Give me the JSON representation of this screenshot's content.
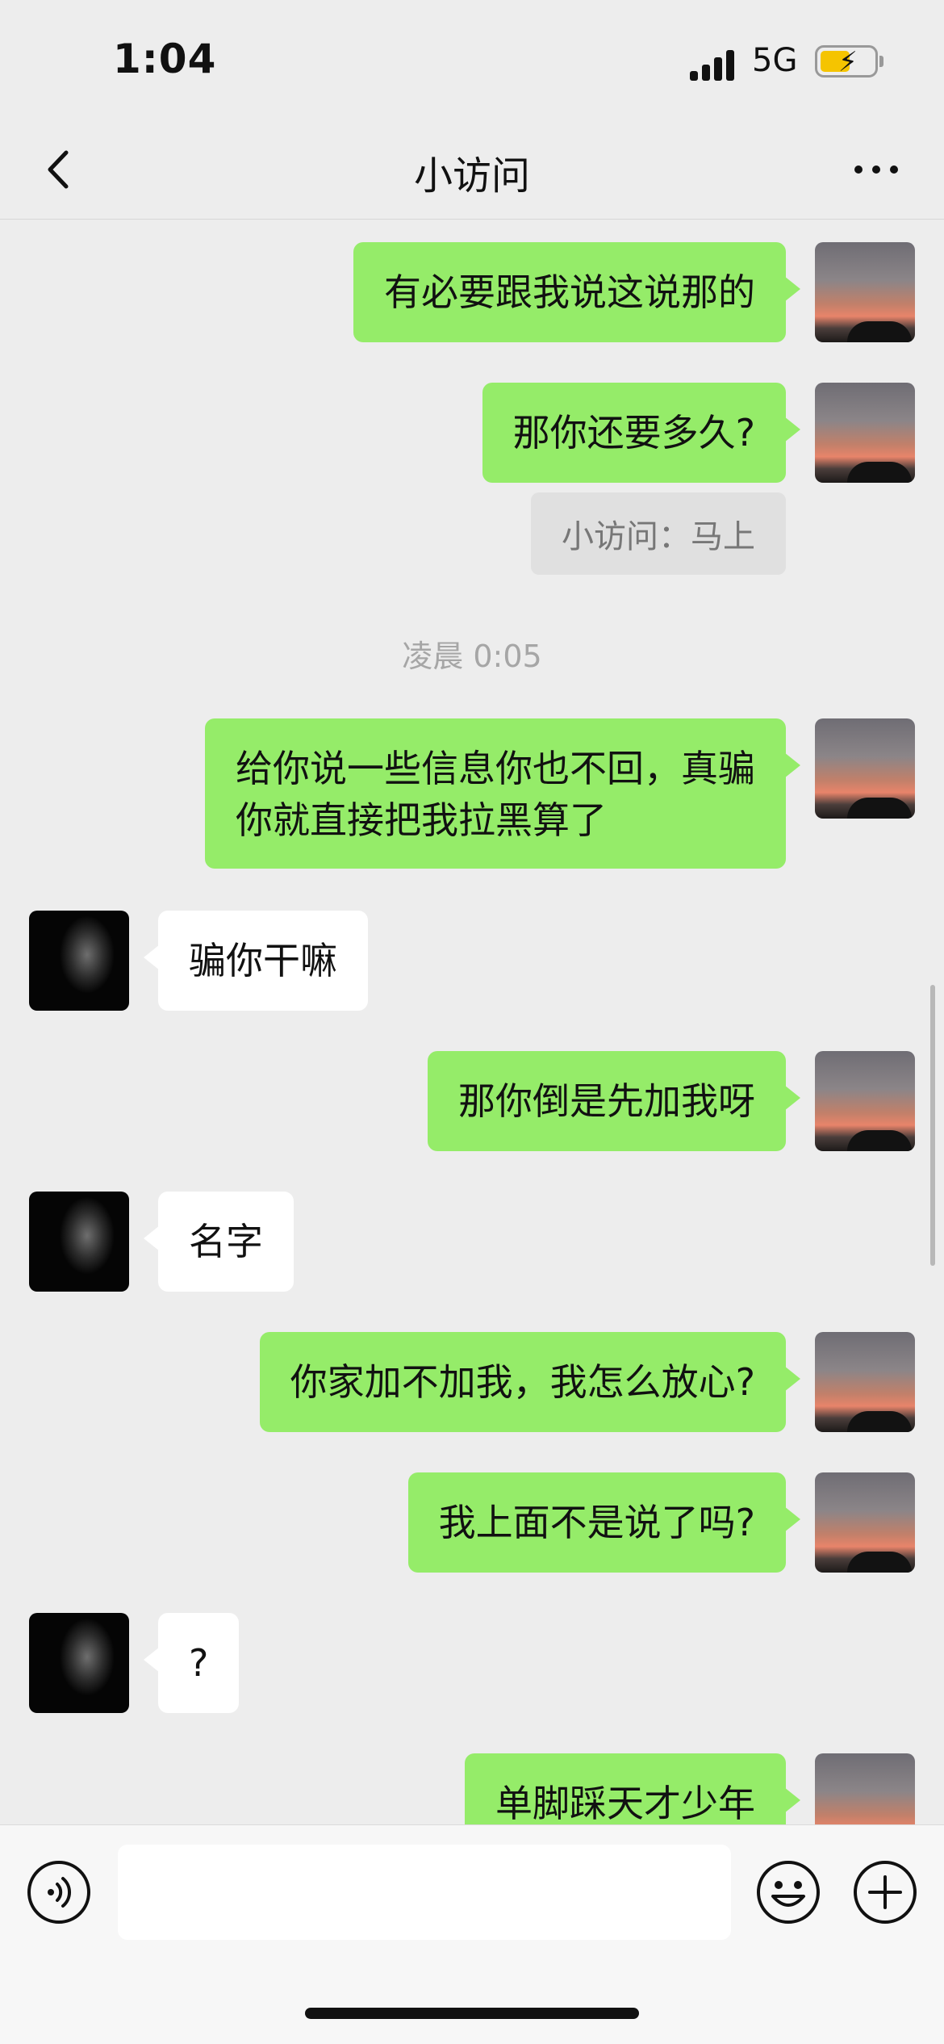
{
  "status_bar": {
    "time": "1:04",
    "network": "5G"
  },
  "nav": {
    "title": "小访问"
  },
  "chat": {
    "messages": [
      {
        "id": "m1",
        "sender": "self",
        "text": "有必要跟我说这说那的"
      },
      {
        "id": "m2",
        "sender": "self",
        "text": "那你还要多久?"
      },
      {
        "id": "q1",
        "type": "quote",
        "text": "小访问：马上"
      },
      {
        "id": "t1",
        "type": "timestamp",
        "text": "凌晨 0:05"
      },
      {
        "id": "m3",
        "sender": "self",
        "text": "给你说一些信息你也不回，真骗\n你就直接把我拉黑算了"
      },
      {
        "id": "m4",
        "sender": "other",
        "text": "骗你干嘛"
      },
      {
        "id": "m5",
        "sender": "self",
        "text": "那你倒是先加我呀"
      },
      {
        "id": "m6",
        "sender": "other",
        "text": "名字"
      },
      {
        "id": "m7",
        "sender": "self",
        "text": "你家加不加我，我怎么放心?"
      },
      {
        "id": "m8",
        "sender": "self",
        "text": "我上面不是说了吗?"
      },
      {
        "id": "m9",
        "sender": "other",
        "text": "?"
      },
      {
        "id": "m10",
        "sender": "self",
        "text": "单脚踩天才少年"
      }
    ]
  },
  "input_bar": {
    "placeholder": "",
    "value": ""
  },
  "icons": {
    "back": "chevron-left-icon",
    "more": "more-horizontal-icon",
    "voice": "voice-icon",
    "emoji": "emoji-icon",
    "plus": "plus-icon"
  },
  "colors": {
    "background": "#ededed",
    "self_bubble": "#95ec69",
    "other_bubble": "#ffffff",
    "timestamp": "#a6a6a6",
    "battery": "#f5c400"
  }
}
